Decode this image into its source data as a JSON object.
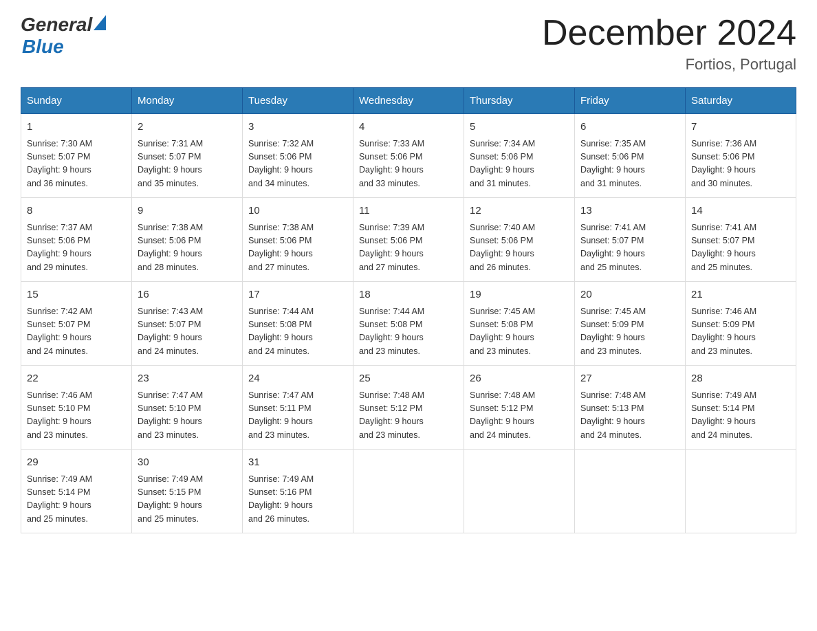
{
  "header": {
    "logo": {
      "general": "General",
      "blue": "Blue"
    },
    "title": "December 2024",
    "location": "Fortios, Portugal"
  },
  "weekdays": [
    "Sunday",
    "Monday",
    "Tuesday",
    "Wednesday",
    "Thursday",
    "Friday",
    "Saturday"
  ],
  "weeks": [
    [
      {
        "day": "1",
        "sunrise": "7:30 AM",
        "sunset": "5:07 PM",
        "daylight": "9 hours and 36 minutes."
      },
      {
        "day": "2",
        "sunrise": "7:31 AM",
        "sunset": "5:07 PM",
        "daylight": "9 hours and 35 minutes."
      },
      {
        "day": "3",
        "sunrise": "7:32 AM",
        "sunset": "5:06 PM",
        "daylight": "9 hours and 34 minutes."
      },
      {
        "day": "4",
        "sunrise": "7:33 AM",
        "sunset": "5:06 PM",
        "daylight": "9 hours and 33 minutes."
      },
      {
        "day": "5",
        "sunrise": "7:34 AM",
        "sunset": "5:06 PM",
        "daylight": "9 hours and 31 minutes."
      },
      {
        "day": "6",
        "sunrise": "7:35 AM",
        "sunset": "5:06 PM",
        "daylight": "9 hours and 31 minutes."
      },
      {
        "day": "7",
        "sunrise": "7:36 AM",
        "sunset": "5:06 PM",
        "daylight": "9 hours and 30 minutes."
      }
    ],
    [
      {
        "day": "8",
        "sunrise": "7:37 AM",
        "sunset": "5:06 PM",
        "daylight": "9 hours and 29 minutes."
      },
      {
        "day": "9",
        "sunrise": "7:38 AM",
        "sunset": "5:06 PM",
        "daylight": "9 hours and 28 minutes."
      },
      {
        "day": "10",
        "sunrise": "7:38 AM",
        "sunset": "5:06 PM",
        "daylight": "9 hours and 27 minutes."
      },
      {
        "day": "11",
        "sunrise": "7:39 AM",
        "sunset": "5:06 PM",
        "daylight": "9 hours and 27 minutes."
      },
      {
        "day": "12",
        "sunrise": "7:40 AM",
        "sunset": "5:06 PM",
        "daylight": "9 hours and 26 minutes."
      },
      {
        "day": "13",
        "sunrise": "7:41 AM",
        "sunset": "5:07 PM",
        "daylight": "9 hours and 25 minutes."
      },
      {
        "day": "14",
        "sunrise": "7:41 AM",
        "sunset": "5:07 PM",
        "daylight": "9 hours and 25 minutes."
      }
    ],
    [
      {
        "day": "15",
        "sunrise": "7:42 AM",
        "sunset": "5:07 PM",
        "daylight": "9 hours and 24 minutes."
      },
      {
        "day": "16",
        "sunrise": "7:43 AM",
        "sunset": "5:07 PM",
        "daylight": "9 hours and 24 minutes."
      },
      {
        "day": "17",
        "sunrise": "7:44 AM",
        "sunset": "5:08 PM",
        "daylight": "9 hours and 24 minutes."
      },
      {
        "day": "18",
        "sunrise": "7:44 AM",
        "sunset": "5:08 PM",
        "daylight": "9 hours and 23 minutes."
      },
      {
        "day": "19",
        "sunrise": "7:45 AM",
        "sunset": "5:08 PM",
        "daylight": "9 hours and 23 minutes."
      },
      {
        "day": "20",
        "sunrise": "7:45 AM",
        "sunset": "5:09 PM",
        "daylight": "9 hours and 23 minutes."
      },
      {
        "day": "21",
        "sunrise": "7:46 AM",
        "sunset": "5:09 PM",
        "daylight": "9 hours and 23 minutes."
      }
    ],
    [
      {
        "day": "22",
        "sunrise": "7:46 AM",
        "sunset": "5:10 PM",
        "daylight": "9 hours and 23 minutes."
      },
      {
        "day": "23",
        "sunrise": "7:47 AM",
        "sunset": "5:10 PM",
        "daylight": "9 hours and 23 minutes."
      },
      {
        "day": "24",
        "sunrise": "7:47 AM",
        "sunset": "5:11 PM",
        "daylight": "9 hours and 23 minutes."
      },
      {
        "day": "25",
        "sunrise": "7:48 AM",
        "sunset": "5:12 PM",
        "daylight": "9 hours and 23 minutes."
      },
      {
        "day": "26",
        "sunrise": "7:48 AM",
        "sunset": "5:12 PM",
        "daylight": "9 hours and 24 minutes."
      },
      {
        "day": "27",
        "sunrise": "7:48 AM",
        "sunset": "5:13 PM",
        "daylight": "9 hours and 24 minutes."
      },
      {
        "day": "28",
        "sunrise": "7:49 AM",
        "sunset": "5:14 PM",
        "daylight": "9 hours and 24 minutes."
      }
    ],
    [
      {
        "day": "29",
        "sunrise": "7:49 AM",
        "sunset": "5:14 PM",
        "daylight": "9 hours and 25 minutes."
      },
      {
        "day": "30",
        "sunrise": "7:49 AM",
        "sunset": "5:15 PM",
        "daylight": "9 hours and 25 minutes."
      },
      {
        "day": "31",
        "sunrise": "7:49 AM",
        "sunset": "5:16 PM",
        "daylight": "9 hours and 26 minutes."
      },
      null,
      null,
      null,
      null
    ]
  ],
  "labels": {
    "sunrise": "Sunrise:",
    "sunset": "Sunset:",
    "daylight": "Daylight:"
  }
}
